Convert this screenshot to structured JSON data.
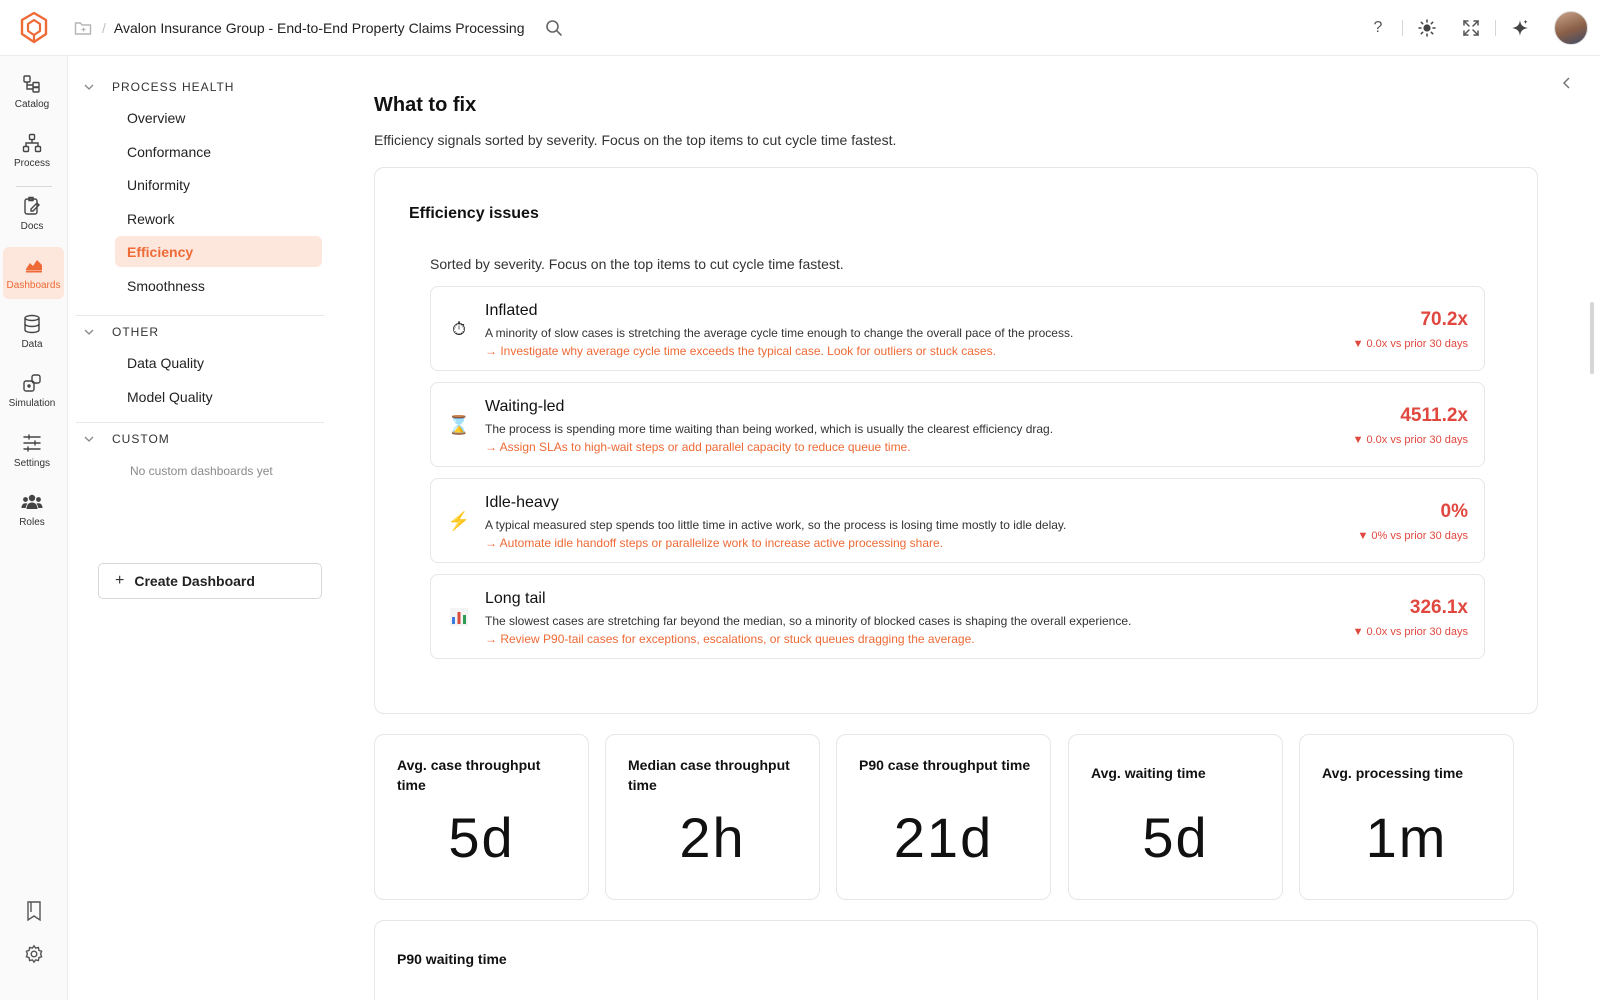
{
  "header": {
    "breadcrumb_title": "Avalon Insurance Group - End-to-End Property Claims Processing",
    "separator": "/",
    "help_label": "?"
  },
  "rail": {
    "items": [
      {
        "label": "Catalog",
        "icon": "catalog-icon"
      },
      {
        "label": "Process",
        "icon": "process-icon"
      },
      {
        "label": "Docs",
        "icon": "docs-icon"
      },
      {
        "label": "Dashboards",
        "icon": "dashboards-icon",
        "active": true
      },
      {
        "label": "Data",
        "icon": "database-icon"
      },
      {
        "label": "Simulation",
        "icon": "simulation-icon"
      },
      {
        "label": "Settings",
        "icon": "sliders-icon"
      },
      {
        "label": "Roles",
        "icon": "people-icon"
      }
    ]
  },
  "sidebar": {
    "sections": {
      "process_health": "PROCESS HEALTH",
      "other": "OTHER",
      "custom": "CUSTOM"
    },
    "process_health_items": [
      "Overview",
      "Conformance",
      "Uniformity",
      "Rework",
      "Efficiency",
      "Smoothness"
    ],
    "active_item": "Efficiency",
    "other_items": [
      "Data Quality",
      "Model Quality"
    ],
    "no_custom": "No custom dashboards yet",
    "create_button": "Create Dashboard",
    "create_plus": "+"
  },
  "main": {
    "title": "What to fix",
    "subtitle": "Efficiency signals sorted by severity. Focus on the top items to cut cycle time fastest.",
    "panel": {
      "title": "Efficiency issues",
      "subtitle": "Sorted by severity. Focus on the top items to cut cycle time fastest.",
      "issues": [
        {
          "icon": "stopwatch-icon",
          "glyph": "⏱",
          "name": "Inflated",
          "description": "A minority of slow cases is stretching the average cycle time enough to change the overall pace of the process.",
          "action": "→ Investigate why average cycle time exceeds the typical case. Look for outliers or stuck cases.",
          "value": "70.2x",
          "delta": "▼ 0.0x vs prior 30 days"
        },
        {
          "icon": "hourglass-icon",
          "glyph": "⌛",
          "name": "Waiting-led",
          "description": "The process is spending more time waiting than being worked, which is usually the clearest efficiency drag.",
          "action": "→ Assign SLAs to high-wait steps or add parallel capacity to reduce queue time.",
          "value": "4511.2x",
          "delta": "▼ 0.0x vs prior 30 days"
        },
        {
          "icon": "lightning-icon",
          "glyph": "⚡",
          "name": "Idle-heavy",
          "description": "A typical measured step spends too little time in active work, so the process is losing time mostly to idle delay.",
          "action": "→ Automate idle handoff steps or parallelize work to increase active processing share.",
          "value": "0%",
          "delta": "▼ 0% vs prior 30 days"
        },
        {
          "icon": "bar-chart-icon",
          "glyph": "📊",
          "name": "Long tail",
          "description": "The slowest cases are stretching far beyond the median, so a minority of blocked cases is shaping the overall experience.",
          "action": "→ Review P90-tail cases for exceptions, escalations, or stuck queues dragging the average.",
          "value": "326.1x",
          "delta": "▼ 0.0x vs prior 30 days"
        }
      ]
    },
    "kpis": [
      {
        "label": "Avg. case throughput time",
        "value": "5d"
      },
      {
        "label": "Median case throughput time",
        "value": "2h"
      },
      {
        "label": "P90 case throughput time",
        "value": "21d"
      },
      {
        "label": "Avg. waiting time",
        "value": "5d"
      },
      {
        "label": "Avg. processing time",
        "value": "1m"
      }
    ],
    "p90_waiting_title": "P90 waiting time"
  },
  "colors": {
    "accent": "#ee6a36",
    "accent_bg": "#fde6dc",
    "severity": "#e0483f"
  }
}
